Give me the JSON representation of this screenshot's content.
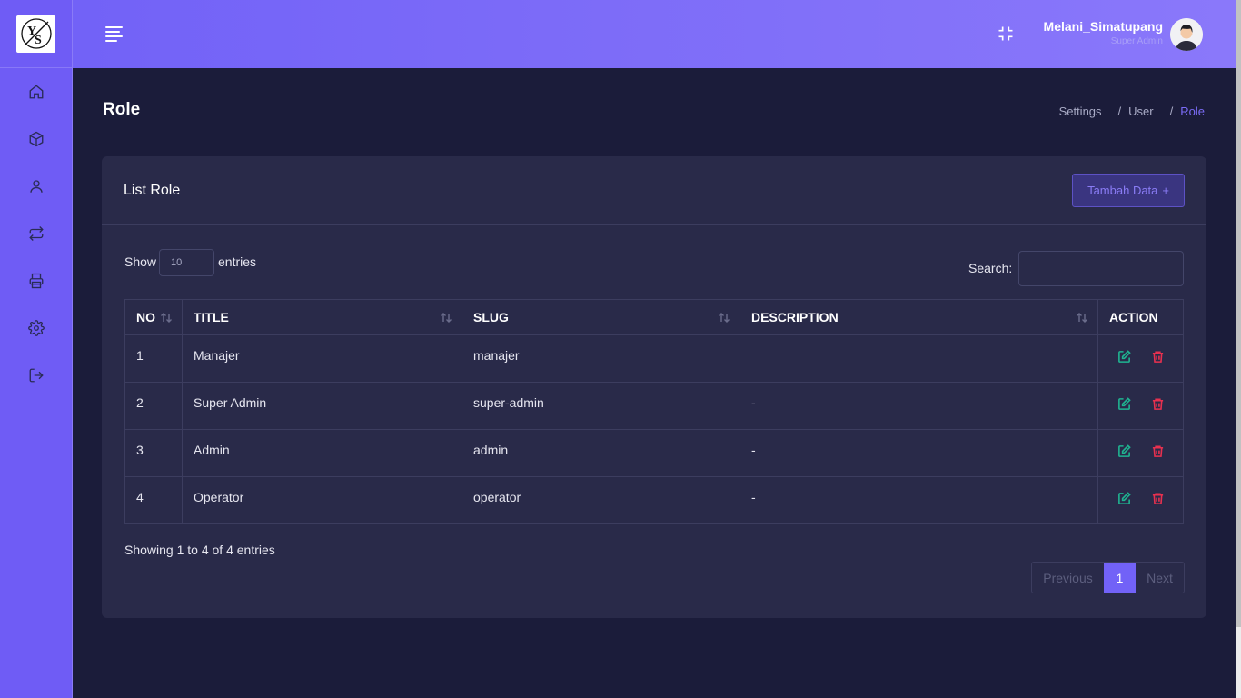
{
  "sidebar": {
    "logo_text": "YS",
    "items": [
      {
        "icon": "home-icon"
      },
      {
        "icon": "box-icon"
      },
      {
        "icon": "user-icon"
      },
      {
        "icon": "transfer-icon"
      },
      {
        "icon": "printer-icon"
      },
      {
        "icon": "settings-icon"
      },
      {
        "icon": "logout-icon"
      }
    ]
  },
  "header": {
    "user_name": "Melani_Simatupang",
    "user_role": "Super Admin"
  },
  "page": {
    "title": "Role",
    "breadcrumb": [
      "Settings",
      "User",
      "Role"
    ]
  },
  "card": {
    "title": "List Role",
    "add_button": "Tambah Data",
    "add_icon": "+",
    "show_label": "Show",
    "entries_value": "10",
    "entries_label": "entries",
    "search_label": "Search:",
    "search_value": ""
  },
  "table": {
    "columns": [
      "NO",
      "TITLE",
      "SLUG",
      "DESCRIPTION",
      "ACTION"
    ],
    "rows": [
      {
        "no": "1",
        "title": "Manajer",
        "slug": "manajer",
        "description": ""
      },
      {
        "no": "2",
        "title": "Super Admin",
        "slug": "super-admin",
        "description": "-"
      },
      {
        "no": "3",
        "title": "Admin",
        "slug": "admin",
        "description": "-"
      },
      {
        "no": "4",
        "title": "Operator",
        "slug": "operator",
        "description": "-"
      }
    ]
  },
  "footer": {
    "info": "Showing 1 to 4 of 4 entries",
    "prev": "Previous",
    "page": "1",
    "next": "Next"
  },
  "colors": {
    "accent": "#7262f7",
    "background": "#1b1c3a",
    "card": "#292a49",
    "edit": "#1fb491",
    "delete": "#e8304f"
  }
}
